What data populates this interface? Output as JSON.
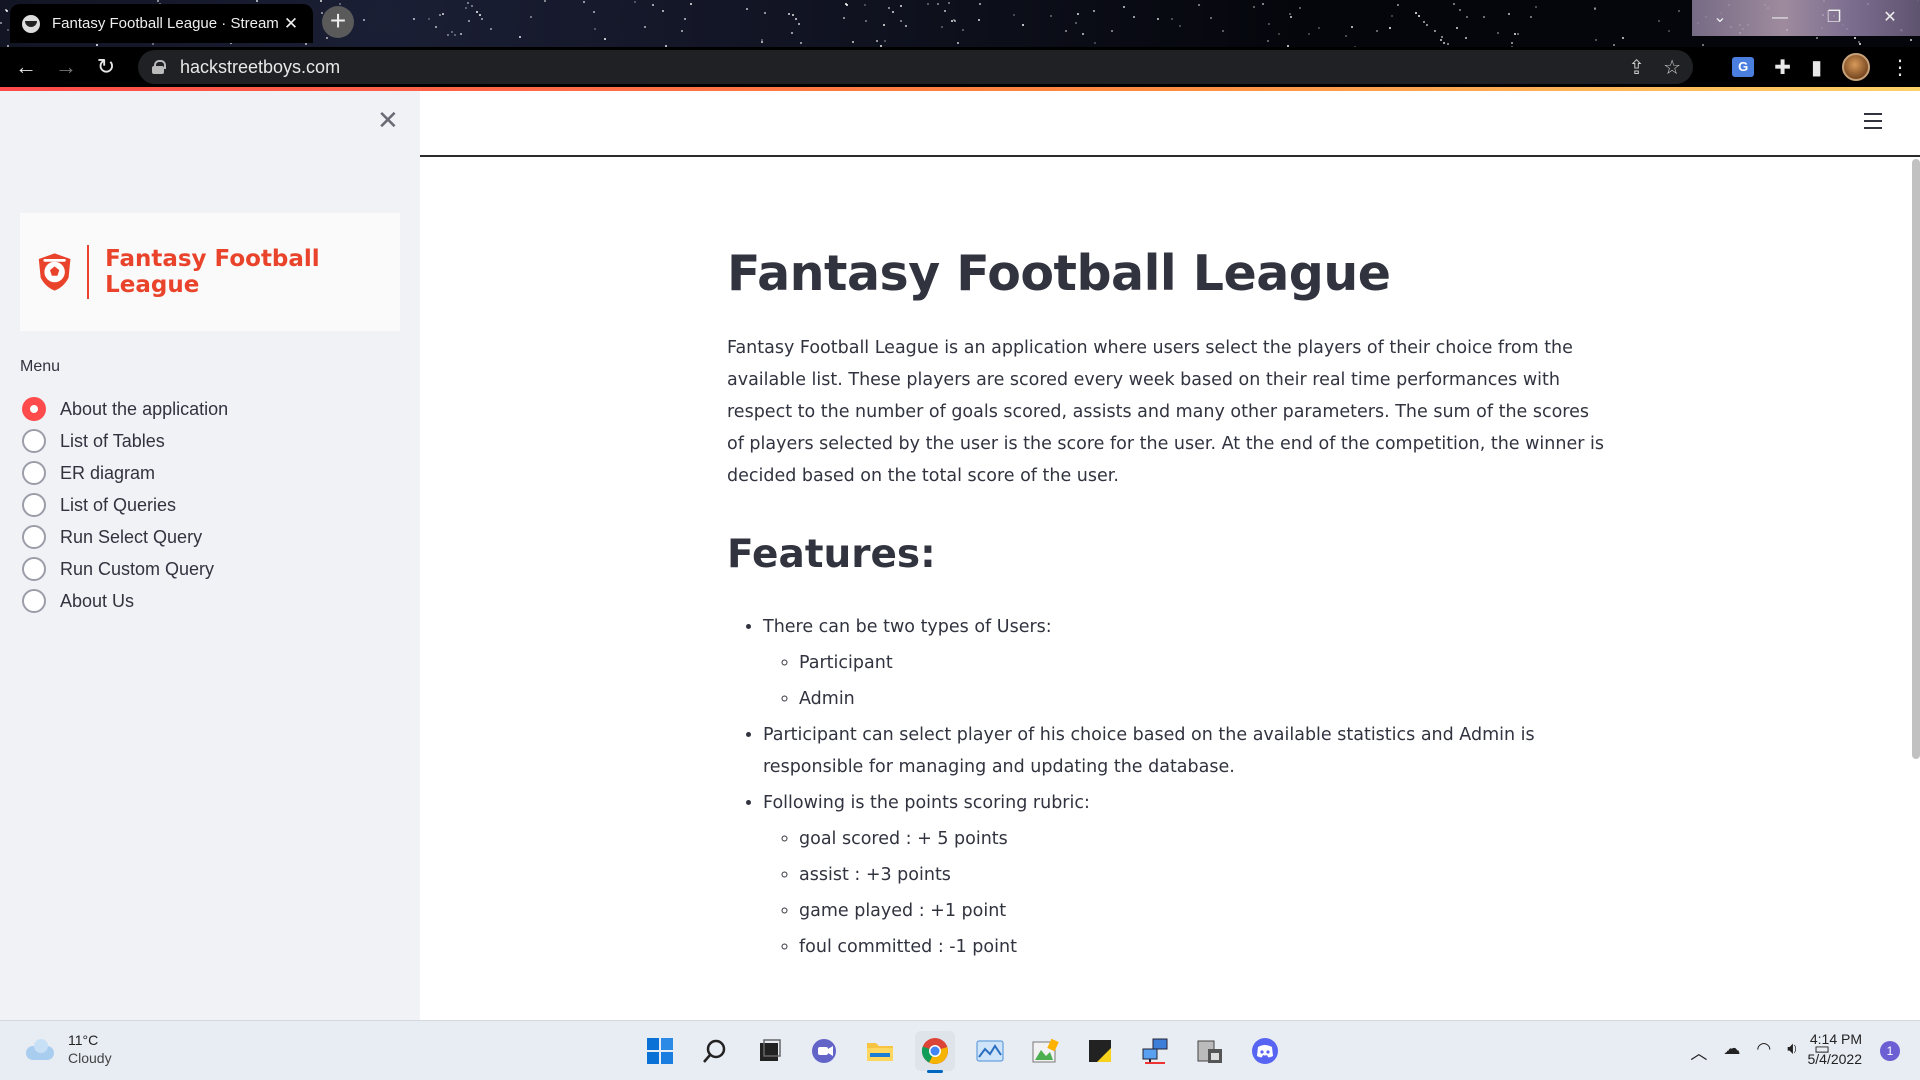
{
  "browser": {
    "tab_title": "Fantasy Football League · Stream",
    "tab_close": "✕",
    "new_tab": "+",
    "url": "hackstreetboys.com",
    "window_controls": {
      "minimize": "—",
      "restore": "❐",
      "close": "✕"
    }
  },
  "sidebar": {
    "close": "✕",
    "logo_text": "Fantasy Football League",
    "menu_label": "Menu",
    "items": [
      {
        "label": "About the application",
        "selected": true
      },
      {
        "label": "List of Tables",
        "selected": false
      },
      {
        "label": "ER diagram",
        "selected": false
      },
      {
        "label": "List of Queries",
        "selected": false
      },
      {
        "label": "Run Select Query",
        "selected": false
      },
      {
        "label": "Run Custom Query",
        "selected": false
      },
      {
        "label": "About Us",
        "selected": false
      }
    ]
  },
  "main": {
    "title": "Fantasy Football League",
    "intro": "Fantasy Football League is an application where users select the players of their choice from the available list. These players are scored every week based on their real time performances with respect to the number of goals scored, assists and many other parameters. The sum of the scores of players selected by the user is the score for the user. At the end of the competition, the winner is decided based on the total score of the user.",
    "features_heading": "Features:",
    "features": [
      {
        "text": "There can be two types of Users:",
        "sub": [
          "Participant",
          "Admin"
        ]
      },
      {
        "text": "Participant can select player of his choice based on the available statistics and Admin is responsible for managing and updating the database.",
        "sub": []
      },
      {
        "text": "Following is the points scoring rubric:",
        "sub": [
          "goal scored : + 5 points",
          "assist : +3 points",
          "game played : +1 point",
          "foul committed : -1 point"
        ]
      }
    ]
  },
  "taskbar": {
    "temperature": "11°C",
    "condition": "Cloudy",
    "time": "4:14 PM",
    "date": "5/4/2022",
    "notification_count": "1"
  },
  "colors": {
    "accent": "#ff4b4b",
    "logo": "#e9442b",
    "text": "#31333f",
    "sidebar_bg": "#f0f2f6"
  }
}
